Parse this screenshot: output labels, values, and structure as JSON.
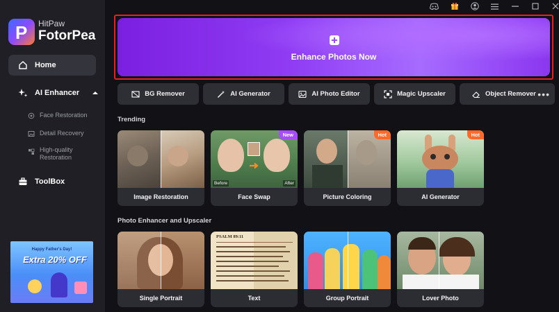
{
  "app": {
    "brand_small": "HitPaw",
    "brand_large": "FotorPea",
    "logo_letter": "P"
  },
  "window_controls": [
    "discord-icon",
    "gift-icon",
    "account-icon",
    "menu-icon",
    "minimize-icon",
    "maximize-icon",
    "close-icon"
  ],
  "sidebar": {
    "home": "Home",
    "ai_enhancer": "AI Enhancer",
    "sub_items": [
      "Face Restoration",
      "Detail Recovery",
      "High-quality Restoration"
    ],
    "toolbox": "ToolBox"
  },
  "promo": {
    "top": "Happy Father's Day!",
    "main": "Extra 20% OFF"
  },
  "hero": {
    "label": "Enhance Photos Now"
  },
  "tools": [
    "BG Remover",
    "AI Generator",
    "AI Photo Editor",
    "Magic Upscaler",
    "Object Remover"
  ],
  "more": "•••",
  "trending": {
    "title": "Trending",
    "cards": [
      {
        "caption": "Image Restoration",
        "badge": ""
      },
      {
        "caption": "Face Swap",
        "badge": "New",
        "before": "Before",
        "after": "After"
      },
      {
        "caption": "Picture Coloring",
        "badge": "Hot"
      },
      {
        "caption": "AI Generator",
        "badge": "Hot"
      }
    ]
  },
  "enhancer": {
    "title": "Photo Enhancer and Upscaler",
    "cards": [
      {
        "caption": "Single Portrait"
      },
      {
        "caption": "Text",
        "page_header": "PSALM 89:11"
      },
      {
        "caption": "Group Portrait"
      },
      {
        "caption": "Lover Photo"
      }
    ]
  },
  "colors": {
    "accent": "#8f3cf4",
    "hot": "#ff6a2a",
    "new": "#a64dff",
    "outline": "#e02424",
    "sidebar": "#1f1f25",
    "background": "#121216"
  }
}
